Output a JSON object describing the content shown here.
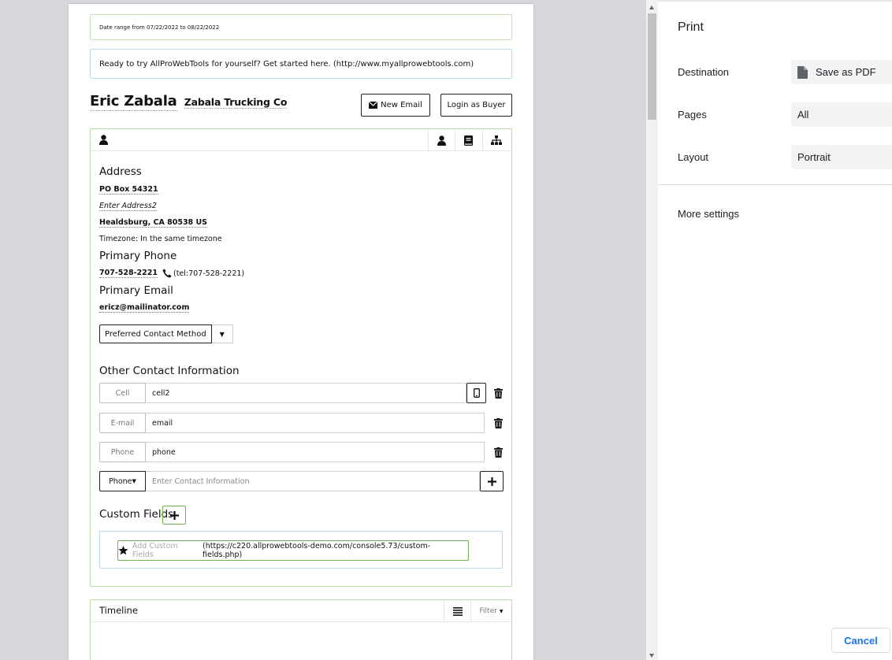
{
  "preview": {
    "date_range": "Date range from 07/22/2022 to 08/22/2022",
    "promo": "Ready to try AllProWebTools for yourself? Get started here. (http://www.myallprowebtools.com)",
    "contact_name": "Eric Zabala",
    "company": "Zabala Trucking Co",
    "buttons": {
      "new_email": "New Email",
      "login_as_buyer": "Login as Buyer"
    },
    "address": {
      "title": "Address",
      "line1": "PO Box 54321",
      "line2_placeholder": "Enter Address2",
      "city_line": "Healdsburg, CA 80538 US",
      "timezone": "Timezone: In the same timezone"
    },
    "primary_phone": {
      "title": "Primary Phone",
      "number": "707-528-2221",
      "tel": "(tel:707-528-2221)"
    },
    "primary_email": {
      "title": "Primary Email",
      "email": "ericz@mailinator.com"
    },
    "preferred_contact_method": "Preferred Contact Method",
    "other_contact": {
      "title": "Other Contact Information",
      "rows": [
        {
          "label": "Cell",
          "value": "cell2"
        },
        {
          "label": "E-mail",
          "value": "email"
        },
        {
          "label": "Phone",
          "value": "phone"
        }
      ],
      "new_type": "Phone",
      "new_placeholder": "Enter Contact Information"
    },
    "custom_fields": {
      "title": "Custom Fields",
      "link_label": "Add Custom Fields",
      "link_url": "(https://c220.allprowebtools-demo.com/console5.73/custom-fields.php)"
    },
    "timeline": {
      "title": "Timeline",
      "filter": "Filter"
    }
  },
  "print_panel": {
    "title": "Print",
    "destination_label": "Destination",
    "destination_value": "Save as PDF",
    "pages_label": "Pages",
    "pages_value": "All",
    "layout_label": "Layout",
    "layout_value": "Portrait",
    "more_settings": "More settings",
    "cancel": "Cancel"
  },
  "colors": {
    "accent_green": "#6db54c",
    "cancel_blue": "#1a73e8"
  },
  "icons": [
    "envelope-icon",
    "person-icon",
    "book-icon",
    "org-chart-icon",
    "phone-icon",
    "mobile-icon",
    "trash-icon",
    "plus-icon",
    "star-icon",
    "list-icon",
    "pdf-file-icon"
  ]
}
